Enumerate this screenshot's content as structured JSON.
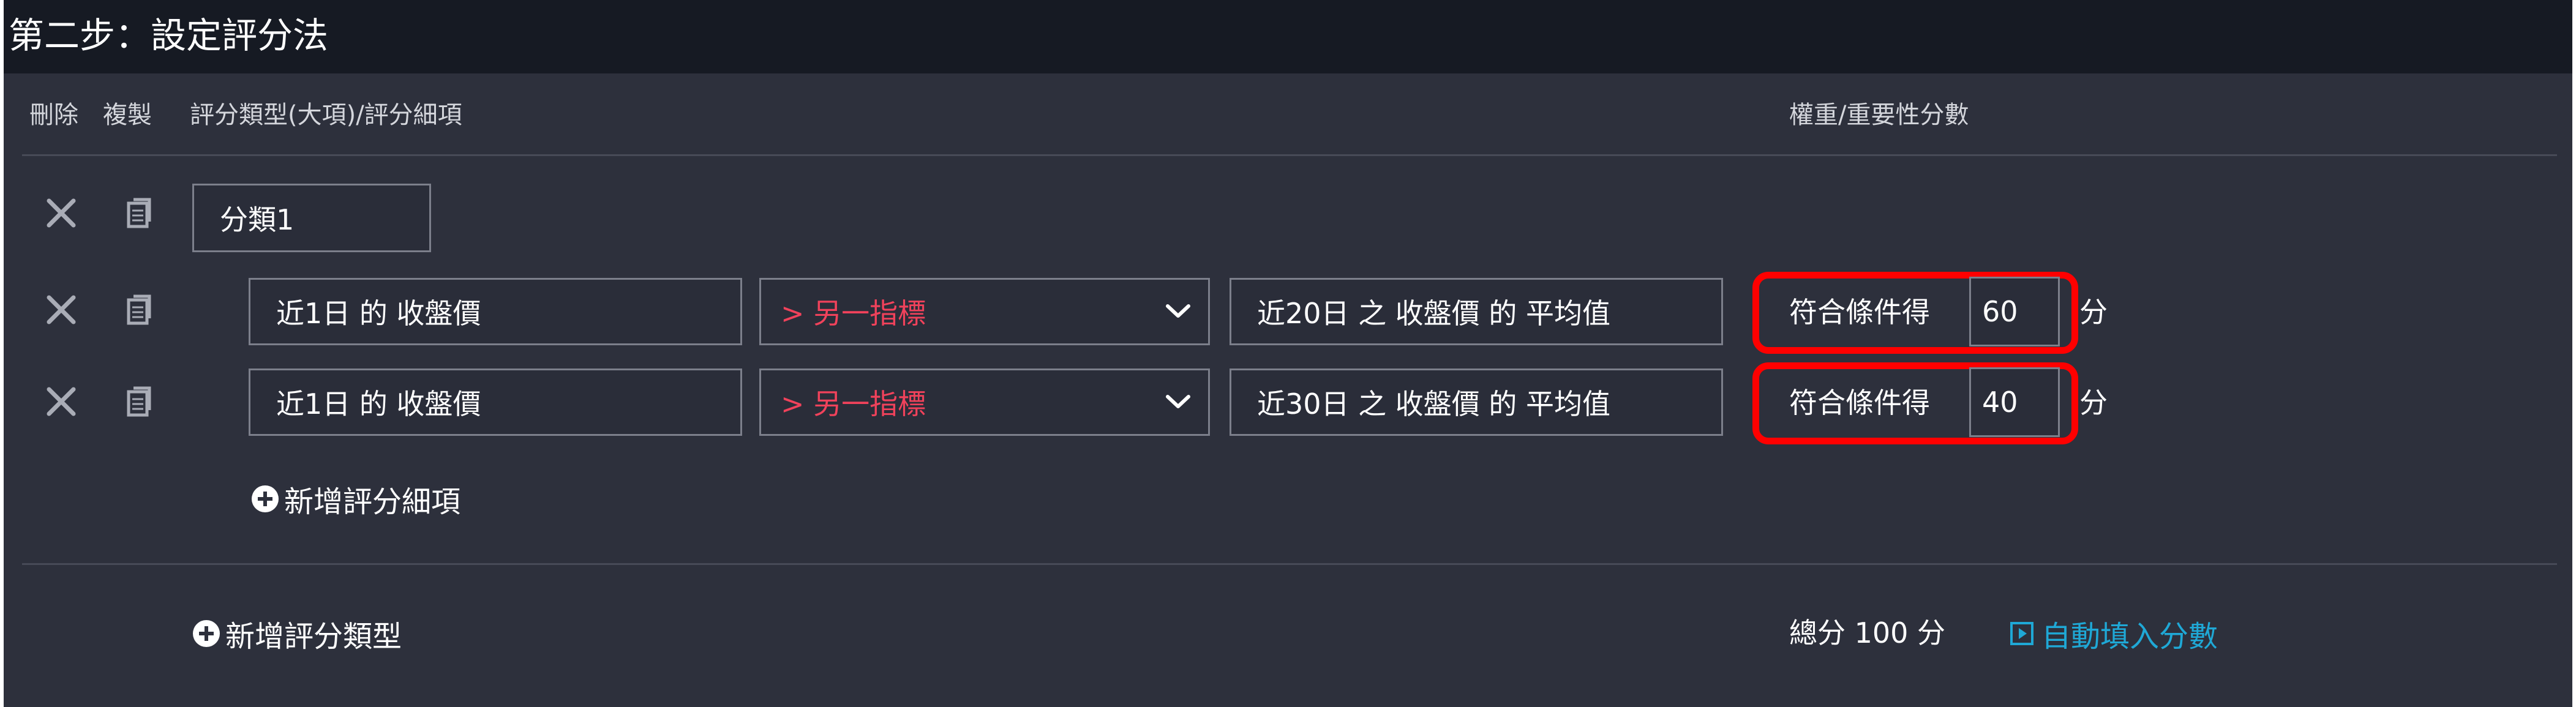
{
  "title": "第二步：設定評分法",
  "headers": {
    "delete": "刪除",
    "copy": "複製",
    "type": "評分類型(大項)/評分細項",
    "weight": "權重/重要性分數"
  },
  "category": {
    "name": "分類1"
  },
  "rows": [
    {
      "left": "近1日 的 收盤價",
      "op": "> 另一指標",
      "right": "近20日 之 收盤價 的 平均值",
      "score_label": "符合條件得",
      "score": "60",
      "unit": "分"
    },
    {
      "left": "近1日 的 收盤價",
      "op": "> 另一指標",
      "right": "近30日 之 收盤價 的 平均值",
      "score_label": "符合條件得",
      "score": "40",
      "unit": "分"
    }
  ],
  "add_detail": "新增評分細項",
  "add_type": "新增評分類型",
  "total": "總分 100 分",
  "autofill": "自動填入分數",
  "colors": {
    "title_bg": "#161a23",
    "panel_bg": "#2d303c",
    "operator_text": "#f0425b",
    "highlight_border": "#ff0000",
    "link": "#1fa8d6"
  },
  "icons": {
    "delete": "close-icon",
    "copy": "copy-icon",
    "dropdown": "chevron-down-icon",
    "add": "plus-circle-icon",
    "autofill": "play-square-icon"
  }
}
